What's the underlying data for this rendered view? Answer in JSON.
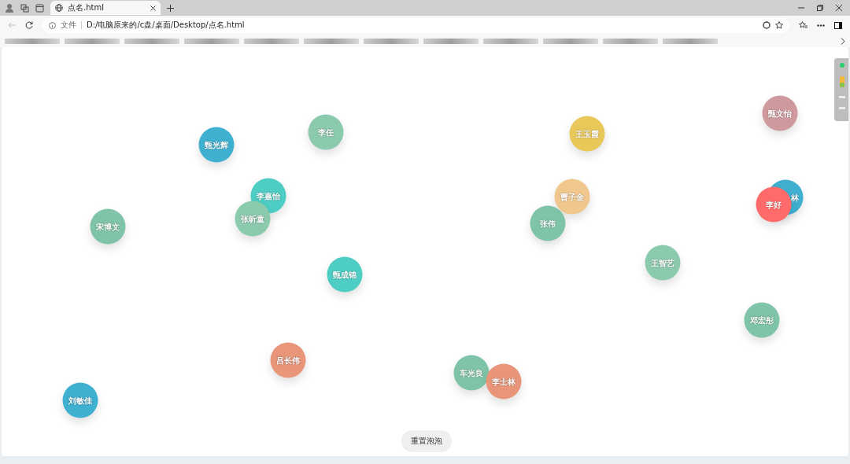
{
  "window": {
    "tab_title": "点名.html",
    "address_label": "文件",
    "address": "D:/电脑原来的/c盘/桌面/Desktop/点名.html"
  },
  "bubbles": [
    {
      "name": "甄光辉",
      "color": "#3fb0d0",
      "kind": "full"
    },
    {
      "name": "李任",
      "color": "#8ccaae",
      "kind": "full"
    },
    {
      "name": "李嘉怡",
      "color": "#4ecdc4",
      "kind": "full"
    },
    {
      "name": "张昕童",
      "color": "#8ccaae",
      "kind": "full"
    },
    {
      "name": "宋博文",
      "color": "#7fc4a8",
      "kind": "full"
    },
    {
      "name": "甄成锦",
      "color": "#4ecdc4",
      "kind": "full"
    },
    {
      "name": "王玉霞",
      "color": "#e9c85a",
      "kind": "full"
    },
    {
      "name": "曹子金",
      "color": "#f0c88e",
      "kind": "full"
    },
    {
      "name": "张伟",
      "color": "#7fc4a8",
      "kind": "full"
    },
    {
      "name": "王智艺",
      "color": "#8ccaae",
      "kind": "full"
    },
    {
      "name": "甄文怡",
      "color": "#cf9a9e",
      "kind": "full"
    },
    {
      "name": "林",
      "color": "#3fb0d0",
      "kind": "covered"
    },
    {
      "name": "李好",
      "color": "#ff6b6b",
      "kind": "full"
    },
    {
      "name": "邓宏彤",
      "color": "#7fc4a8",
      "kind": "full"
    },
    {
      "name": "吕长伟",
      "color": "#e8957a",
      "kind": "full"
    },
    {
      "name": "车光良",
      "color": "#7fc4a8",
      "kind": "full"
    },
    {
      "name": "李士林",
      "color": "#e8957a",
      "kind": "full"
    },
    {
      "name": "刘敏佳",
      "color": "#3fb0d0",
      "kind": "full"
    }
  ],
  "reset_button": "重置泡泡"
}
